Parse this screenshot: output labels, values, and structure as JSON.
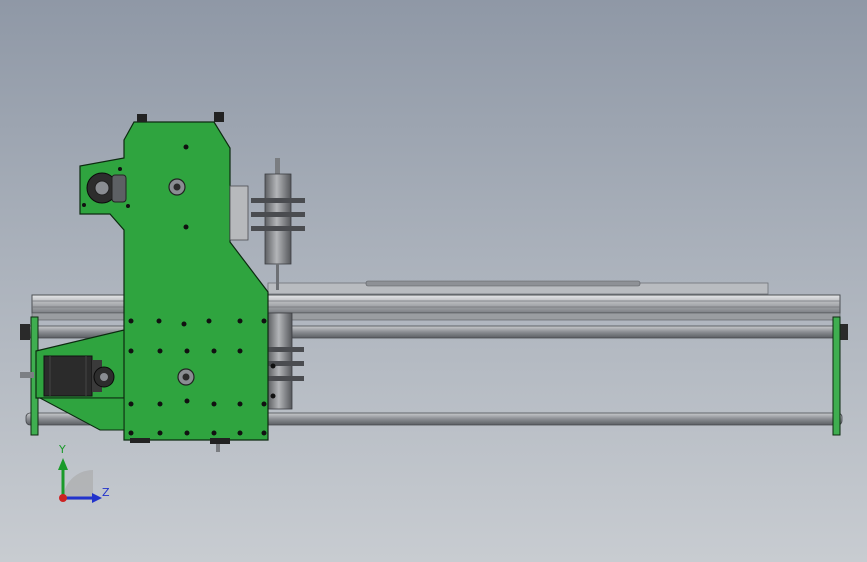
{
  "triad": {
    "y_label": "Y",
    "z_label": "Z"
  },
  "colors": {
    "background_top": "#8f98a6",
    "background_bottom": "#c8ccd1",
    "green_plate": "#2fa43f",
    "plate_outline": "#0c2a10",
    "rod_gray": "#8a8d92",
    "motor_dark": "#2b2b2b",
    "y_axis": "#1a9a2a",
    "z_axis": "#2233cc",
    "x_axis": "#cc2222"
  }
}
